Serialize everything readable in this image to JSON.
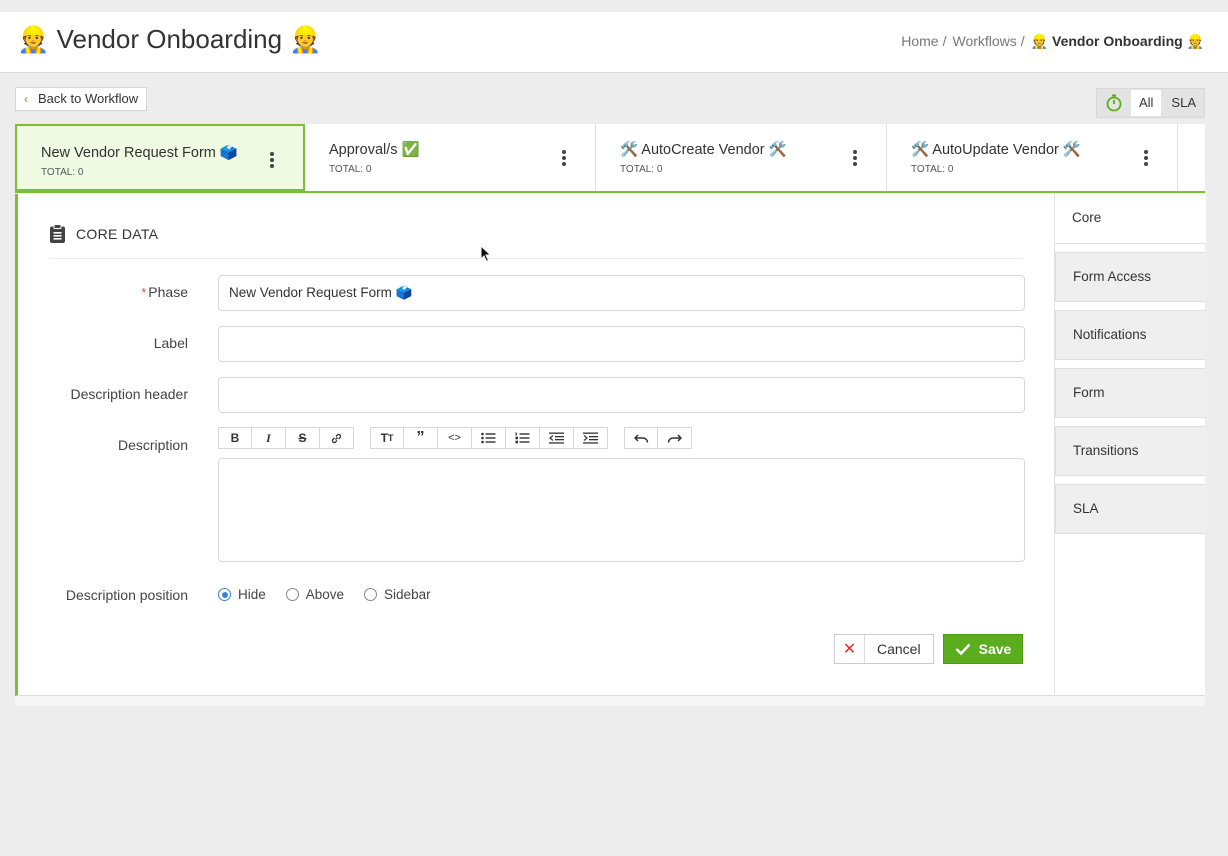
{
  "header": {
    "title": "👷 Vendor Onboarding 👷",
    "breadcrumb": [
      "Home",
      "Workflows",
      "👷 Vendor Onboarding 👷"
    ],
    "separator": "/"
  },
  "back_button": {
    "label": "Back to Workflow"
  },
  "filters": {
    "items": [
      "All",
      "SLA"
    ],
    "selected": "All",
    "timer_icon": "stopwatch-icon"
  },
  "phases": [
    {
      "name": "New Vendor Request Form 🗳️",
      "total": "TOTAL: 0"
    },
    {
      "name": "Approval/s ✅",
      "total": "TOTAL: 0"
    },
    {
      "name": "🛠️ AutoCreate Vendor 🛠️",
      "total": "TOTAL: 0"
    },
    {
      "name": "🛠️ AutoUpdate Vendor 🛠️",
      "total": "TOTAL: 0"
    }
  ],
  "form": {
    "section_title": "CORE DATA",
    "phase": {
      "label": "Phase",
      "value": "New Vendor Request Form 🗳️"
    },
    "label": {
      "label": "Label",
      "value": ""
    },
    "description_header": {
      "label": "Description header",
      "value": ""
    },
    "description": {
      "label": "Description",
      "value": ""
    },
    "description_position": {
      "label": "Description position",
      "options": [
        "Hide",
        "Above",
        "Sidebar"
      ],
      "selected": "Hide"
    },
    "cancel_label": "Cancel",
    "save_label": "Save"
  },
  "side_tabs": [
    "Core",
    "Form Access",
    "Notifications",
    "Form",
    "Transitions",
    "SLA"
  ],
  "active_side_tab": "Core",
  "colors": {
    "accent": "#7cbd3a",
    "save": "#5aad1c",
    "cancel_icon": "#d9342b",
    "radio": "#3b82d6"
  }
}
